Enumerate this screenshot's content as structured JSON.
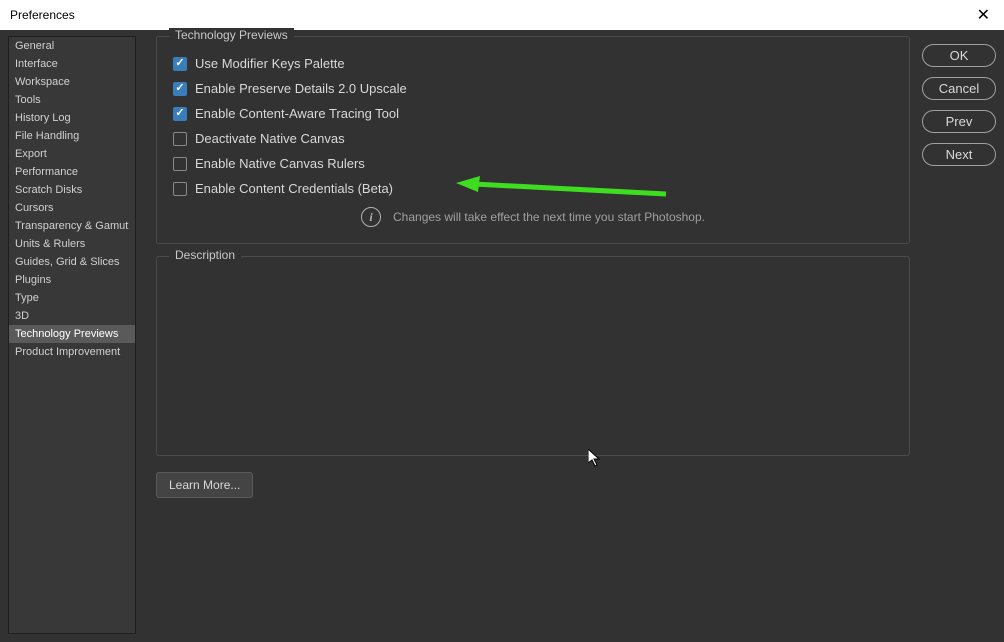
{
  "window": {
    "title": "Preferences"
  },
  "sidebar": {
    "items": [
      {
        "label": "General"
      },
      {
        "label": "Interface"
      },
      {
        "label": "Workspace"
      },
      {
        "label": "Tools"
      },
      {
        "label": "History Log"
      },
      {
        "label": "File Handling"
      },
      {
        "label": "Export"
      },
      {
        "label": "Performance"
      },
      {
        "label": "Scratch Disks"
      },
      {
        "label": "Cursors"
      },
      {
        "label": "Transparency & Gamut"
      },
      {
        "label": "Units & Rulers"
      },
      {
        "label": "Guides, Grid & Slices"
      },
      {
        "label": "Plugins"
      },
      {
        "label": "Type"
      },
      {
        "label": "3D"
      },
      {
        "label": "Technology Previews"
      },
      {
        "label": "Product Improvement"
      }
    ],
    "selected_index": 16
  },
  "panel": {
    "section_title": "Technology Previews",
    "options": [
      {
        "label": "Use Modifier Keys Palette",
        "checked": true
      },
      {
        "label": "Enable Preserve Details 2.0 Upscale",
        "checked": true
      },
      {
        "label": "Enable Content-Aware Tracing Tool",
        "checked": true
      },
      {
        "label": "Deactivate Native Canvas",
        "checked": false
      },
      {
        "label": "Enable Native Canvas Rulers",
        "checked": false
      },
      {
        "label": "Enable Content Credentials (Beta)",
        "checked": false
      }
    ],
    "notice": "Changes will take effect the next time you start Photoshop.",
    "description_title": "Description",
    "learn_more": "Learn More..."
  },
  "buttons": {
    "ok": "OK",
    "cancel": "Cancel",
    "prev": "Prev",
    "next": "Next"
  },
  "annotation": {
    "arrow_color": "#3fdd1f"
  }
}
